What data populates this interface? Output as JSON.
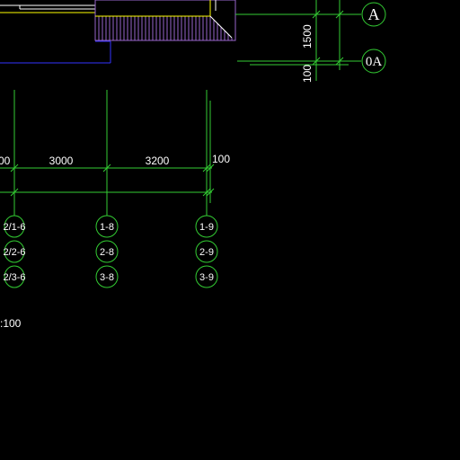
{
  "colors": {
    "background": "#000000",
    "grid_line": "#33cc33",
    "wall_outline": "#3333ff",
    "hatch": "#9966cc",
    "yellow_line": "#ffff00",
    "white_line": "#ffffff",
    "text": "#ffffff"
  },
  "dimensions": {
    "horizontal": [
      "00",
      "3000",
      "3200",
      "100"
    ],
    "vertical": [
      "1500",
      "100"
    ]
  },
  "axis_bubbles": {
    "row_A": "A",
    "row_0A": "0A"
  },
  "column_bubbles": {
    "left": [
      "2/1-6",
      "2/2-6",
      "2/3-6"
    ],
    "middle": [
      "1-8",
      "2-8",
      "3-8"
    ],
    "right": [
      "1-9",
      "2-9",
      "3-9"
    ]
  },
  "scale_note": ":100"
}
